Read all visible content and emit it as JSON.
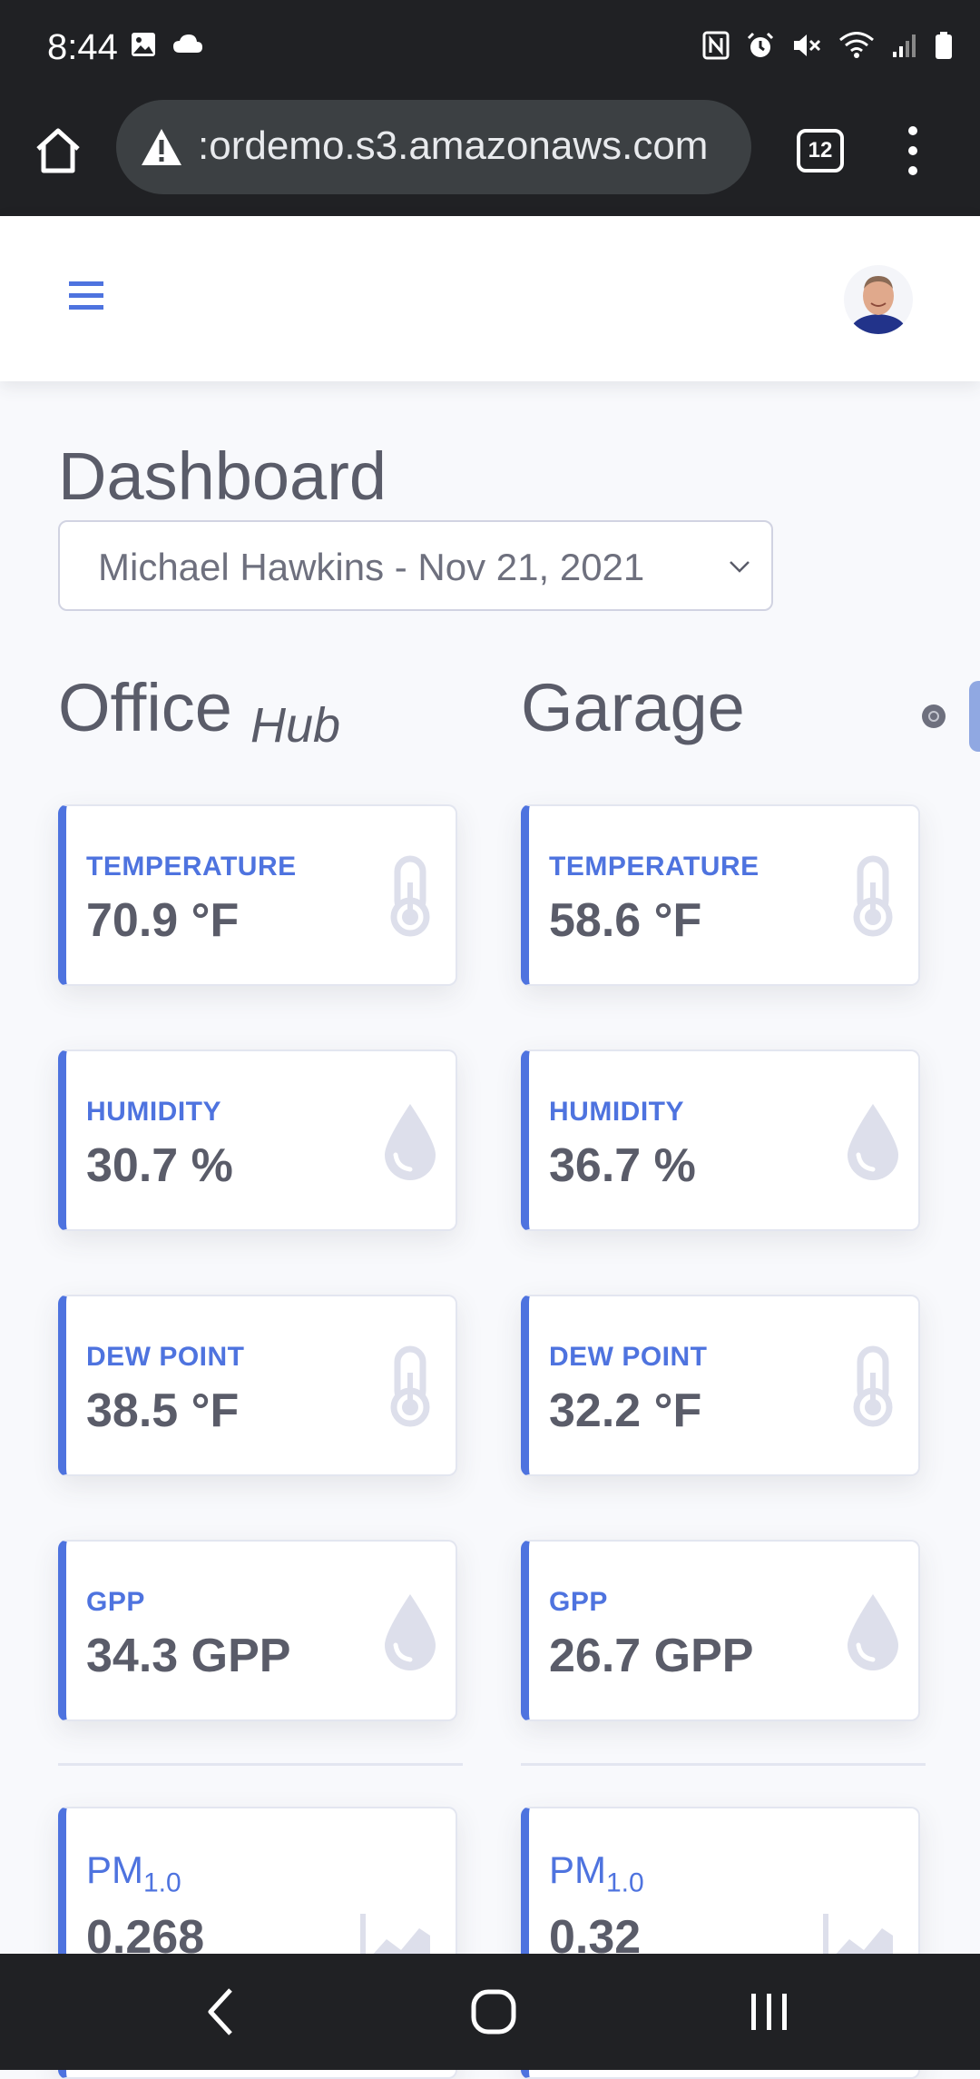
{
  "status_bar": {
    "time": "8:44"
  },
  "browser": {
    "url": ":ordemo.s3.amazonaws.com",
    "tab_count": "12"
  },
  "page": {
    "title": "Dashboard",
    "date_select": {
      "value": "Michael Hawkins - Nov 21, 2021"
    }
  },
  "columns": [
    {
      "title": "Office",
      "subtitle": "Hub",
      "cards": [
        {
          "label": "TEMPERATURE",
          "value": "70.9 °F",
          "icon": "thermometer-icon"
        },
        {
          "label": "HUMIDITY",
          "value": "30.7 %",
          "icon": "droplet-icon"
        },
        {
          "label": "DEW POINT",
          "value": "38.5 °F",
          "icon": "thermometer-icon"
        },
        {
          "label": "GPP",
          "value": "34.3 GPP",
          "icon": "droplet-icon"
        }
      ],
      "pm": {
        "label": "PM",
        "label_sub": "1.0",
        "value": "0.268",
        "icon": "chart-area-icon"
      }
    },
    {
      "title": "Garage",
      "subtitle": "",
      "cards": [
        {
          "label": "TEMPERATURE",
          "value": "58.6 °F",
          "icon": "thermometer-icon"
        },
        {
          "label": "HUMIDITY",
          "value": "36.7 %",
          "icon": "droplet-icon"
        },
        {
          "label": "DEW POINT",
          "value": "32.2 °F",
          "icon": "thermometer-icon"
        },
        {
          "label": "GPP",
          "value": "26.7 GPP",
          "icon": "droplet-icon"
        }
      ],
      "pm": {
        "label": "PM",
        "label_sub": "1.0",
        "value": "0.32",
        "icon": "chart-area-icon"
      }
    }
  ],
  "colors": {
    "accent": "#4e73df",
    "text": "#5a5c69",
    "background": "#f8f9fc",
    "icon_muted": "#dddfeb"
  }
}
